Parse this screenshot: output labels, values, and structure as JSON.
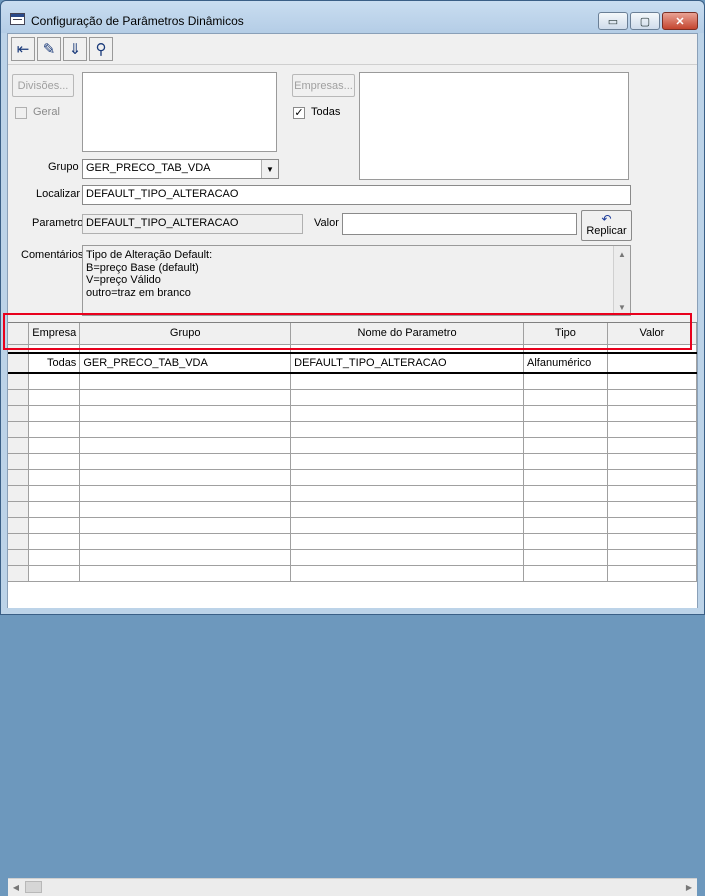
{
  "window": {
    "title": "Configuração de Parâmetros Dinâmicos",
    "minimize": "▭",
    "maximize": "▢",
    "close": "✕"
  },
  "toolbar": {
    "exit_glyph": "⇤",
    "edit_glyph": "✎",
    "save_glyph": "⇓",
    "find_glyph": "⚲"
  },
  "divisoes": {
    "button": "Divisões...",
    "geral_label": "Geral",
    "geral_checked": false
  },
  "empresas": {
    "button": "Empresas...",
    "todas_label": "Todas",
    "todas_checked": true,
    "check_mark": "✓"
  },
  "grupo": {
    "label": "Grupo",
    "value": "GER_PRECO_TAB_VDA",
    "arrow": "▼"
  },
  "localizar": {
    "label": "Localizar",
    "value": "DEFAULT_TIPO_ALTERACAO"
  },
  "parametro": {
    "label": "Parametro",
    "value": "DEFAULT_TIPO_ALTERACAO"
  },
  "valor": {
    "label": "Valor",
    "value": ""
  },
  "replicar": {
    "label": "Replicar",
    "glyph": "↶"
  },
  "comentarios": {
    "label": "Comentários",
    "text": "Tipo de Alteração Default:\nB=preço Base (default)\nV=preço Válido\noutro=traz em branco",
    "up": "▲",
    "down": "▼"
  },
  "grid": {
    "columns": [
      "Empresa",
      "Grupo",
      "Nome do Parametro",
      "Tipo",
      "Valor"
    ],
    "rows": [
      {
        "empresa": "Todas",
        "grupo": "GER_PRECO_TAB_VDA",
        "nome": "DEFAULT_TIPO_ALTERACAO",
        "tipo": "Alfanumérico",
        "valor": ""
      }
    ],
    "scroll_left": "◀",
    "scroll_right": "▶"
  },
  "colors": {
    "highlight": "#e8001c",
    "titlebar": "#bcd3e8"
  }
}
